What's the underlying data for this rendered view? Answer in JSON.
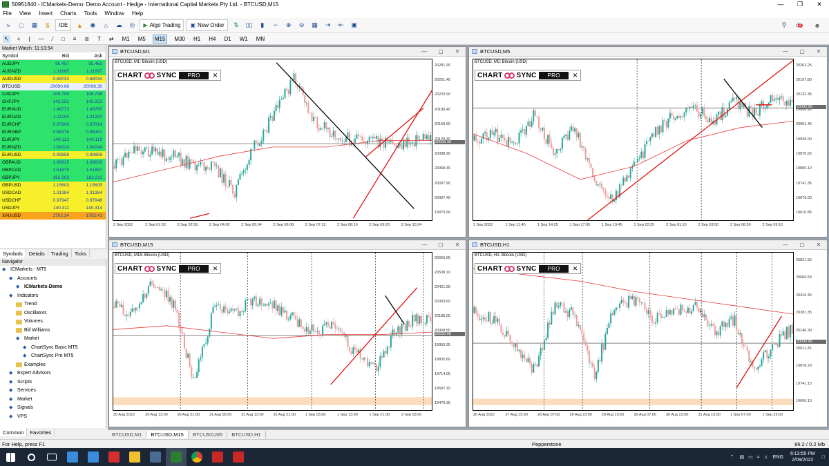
{
  "window": {
    "title": "50951840 - ICMarkets-Demo: Demo Account - Hedge - International Capital Markets Pty Ltd. - BTCUSD,M15"
  },
  "menu": [
    "File",
    "View",
    "Insert",
    "Charts",
    "Tools",
    "Window",
    "Help"
  ],
  "toolbar": {
    "ide": "IDE",
    "algo_trading": "Algo Trading",
    "new_order": "New Order",
    "notification_count": "2"
  },
  "timeframes": [
    "M1",
    "M5",
    "M15",
    "M30",
    "H1",
    "H4",
    "D1",
    "W1",
    "MN"
  ],
  "active_timeframe": "M15",
  "market_watch": {
    "header": "Market Watch: 11:13:54",
    "columns": [
      "Symbol",
      "Bid",
      "Ask"
    ],
    "rows": [
      {
        "s": "AUDJPY",
        "b": "95.457",
        "a": "95.463",
        "c": "#2ee36b"
      },
      {
        "s": "AUDNZD",
        "b": "1.11885",
        "a": "1.11897",
        "c": "#2ee36b"
      },
      {
        "s": "AUDUSD",
        "b": "0.68033",
        "a": "0.68034",
        "c": "#f6ef2a"
      },
      {
        "s": "BTCUSD",
        "b": "20090.68",
        "a": "20096.30",
        "c": "#e9f0fb"
      },
      {
        "s": "CADJPY",
        "b": "106.795",
        "a": "106.798",
        "c": "#2ee36b"
      },
      {
        "s": "CHFJPY",
        "b": "143.252",
        "a": "143.253",
        "c": "#2ee36b"
      },
      {
        "s": "EURAUD",
        "b": "1.46773",
        "a": "1.46785",
        "c": "#2ee36b"
      },
      {
        "s": "EURCAD",
        "b": "1.31194",
        "a": "1.31200",
        "c": "#2ee36b"
      },
      {
        "s": "EURCHF",
        "b": "0.97808",
        "a": "0.97814",
        "c": "#2ee36b"
      },
      {
        "s": "EURGBP",
        "b": "0.86378",
        "a": "0.86381",
        "c": "#2ee36b"
      },
      {
        "s": "EURJPY",
        "b": "140.113",
        "a": "140.119",
        "c": "#2ee36b"
      },
      {
        "s": "EURNZD",
        "b": "1.64224",
        "a": "1.64244",
        "c": "#2ee36b"
      },
      {
        "s": "EURUSD",
        "b": "0.99858",
        "a": "0.99859",
        "c": "#f6ef2a"
      },
      {
        "s": "GBPAUD",
        "b": "1.69915",
        "a": "1.69926",
        "c": "#2ee36b"
      },
      {
        "s": "GBPCAD",
        "b": "1.51879",
        "a": "1.51887",
        "c": "#2ee36b"
      },
      {
        "s": "GBPJPY",
        "b": "162.203",
        "a": "162.211",
        "c": "#2ee36b"
      },
      {
        "s": "GBPUSD",
        "b": "1.15603",
        "a": "1.15605",
        "c": "#f6ef2a"
      },
      {
        "s": "USDCAD",
        "b": "1.31384",
        "a": "1.31384",
        "c": "#f6ef2a"
      },
      {
        "s": "USDCHF",
        "b": "0.97947",
        "a": "0.97948",
        "c": "#f6ef2a"
      },
      {
        "s": "USDJPY",
        "b": "140.311",
        "a": "140.314",
        "c": "#f6ef2a"
      },
      {
        "s": "XAUUSD",
        "b": "1702.34",
        "a": "1702.41",
        "c": "#f7a21c"
      }
    ],
    "tabs": [
      "Symbols",
      "Details",
      "Trading",
      "Ticks"
    ]
  },
  "navigator": {
    "header": "Navigator",
    "items": [
      {
        "label": "ICMarkets - MT5",
        "level": 0,
        "icon": "mt5-icon",
        "bold": false
      },
      {
        "label": "Accounts",
        "level": 1,
        "icon": "accounts-icon",
        "bold": false
      },
      {
        "label": "ICMarkets-Demo",
        "level": 2,
        "icon": "account-icon",
        "bold": true
      },
      {
        "label": "Indicators",
        "level": 1,
        "icon": "indicators-icon",
        "bold": false
      },
      {
        "label": "Trend",
        "level": 2,
        "icon": "folder-icon",
        "bold": false
      },
      {
        "label": "Oscillators",
        "level": 2,
        "icon": "folder-icon",
        "bold": false
      },
      {
        "label": "Volumes",
        "level": 2,
        "icon": "folder-icon",
        "bold": false
      },
      {
        "label": "Bill Williams",
        "level": 2,
        "icon": "folder-icon",
        "bold": false
      },
      {
        "label": "Market",
        "level": 2,
        "icon": "market-icon",
        "bold": false
      },
      {
        "label": "ChartSync Basic MT5",
        "level": 3,
        "icon": "indicator-icon",
        "bold": false
      },
      {
        "label": "ChartSync Pro MT5",
        "level": 3,
        "icon": "indicator-icon",
        "bold": false
      },
      {
        "label": "Examples",
        "level": 2,
        "icon": "folder-icon",
        "bold": false
      },
      {
        "label": "Expert Advisors",
        "level": 1,
        "icon": "experts-icon",
        "bold": false
      },
      {
        "label": "Scripts",
        "level": 1,
        "icon": "scripts-icon",
        "bold": false
      },
      {
        "label": "Services",
        "level": 1,
        "icon": "services-icon",
        "bold": false
      },
      {
        "label": "Market",
        "level": 1,
        "icon": "market-icon",
        "bold": false
      },
      {
        "label": "Signals",
        "level": 1,
        "icon": "signals-icon",
        "bold": false
      },
      {
        "label": "VPS",
        "level": 1,
        "icon": "vps-icon",
        "bold": false
      }
    ],
    "tabs": [
      "Common",
      "Favorites"
    ]
  },
  "charts": [
    {
      "id": "m1",
      "title": "BTCUSD,M1",
      "symbol_line": "BTCUSD, M1:  Bitcoin (USD)",
      "prices": [
        "20281.90",
        "20251.40",
        "20220.90",
        "20190.40",
        "20159.90",
        "20129.40",
        "20098.90",
        "20068.40",
        "20037.90",
        "20007.40",
        "19976.90"
      ],
      "current": "20096.30",
      "times": [
        "2 Sep 2022",
        "2 Sep 01:52",
        "2 Sep 02:56",
        "2 Sep 04:00",
        "2 Sep 05:04",
        "2 Sep 06:08",
        "2 Sep 07:12",
        "2 Sep 08:16",
        "2 Sep 09:20",
        "2 Sep 10:24"
      ]
    },
    {
      "id": "m5",
      "title": "BTCUSD,M5",
      "symbol_line": "BTCUSD, M5:  Bitcoin (USD)",
      "prices": [
        "20263.25",
        "20197.80",
        "20132.35",
        "20066.90",
        "20001.45",
        "19936.00",
        "19870.55",
        "19805.10",
        "19741.35",
        "19676.00",
        "19610.85"
      ],
      "current": "20090.68",
      "times": [
        "1 Sep 2022",
        "1 Sep 11:45",
        "1 Sep 14:25",
        "1 Sep 17:05",
        "1 Sep 19:45",
        "1 Sep 22:25",
        "2 Sep 01:10",
        "2 Sep 03:50",
        "2 Sep 06:30",
        "2 Sep 09:10"
      ]
    },
    {
      "id": "m15",
      "title": "BTCUSD,M15",
      "symbol_line": "BTCUSD, M15:  Bitcoin (USD)",
      "prices": [
        "20656.65",
        "20539.10",
        "20421.55",
        "20303.60",
        "20185.05",
        "20068.50",
        "19950.35",
        "19832.60",
        "19714.05",
        "19597.10",
        "19479.35"
      ],
      "current": "20090.68",
      "times": [
        "30 Aug 2022",
        "30 Aug 13:00",
        "30 Aug 21:00",
        "31 Aug 05:00",
        "31 Aug 13:00",
        "31 Aug 21:00",
        "1 Sep 05:00",
        "1 Sep 13:00",
        "1 Sep 21:00",
        "2 Sep 05:00"
      ]
    },
    {
      "id": "h1",
      "title": "BTCUSD,H1",
      "symbol_line": "BTCUSD, H1:  Bitcoin (USD)",
      "prices": [
        "20821.55",
        "20606.50",
        "20416.45",
        "20281.35",
        "20146.30",
        "20011.25",
        "19876.20",
        "19741.15",
        "19606.10"
      ],
      "current": "20090.68",
      "times": [
        "26 Aug 2022",
        "27 Aug 15:00",
        "28 Aug 07:00",
        "28 Aug 23:00",
        "29 Aug 15:00",
        "30 Aug 07:00",
        "30 Aug 23:00",
        "31 Aug 15:00",
        "1 Sep 07:00",
        "1 Sep 23:00"
      ]
    }
  ],
  "chartsync": {
    "left": "CHART",
    "right": "SYNC",
    "badge": "PRO",
    "close": "✕"
  },
  "chart_tabs": [
    "BTCUSD,M1",
    "BTCUSD,M15",
    "BTCUSD,M5",
    "BTCUSD,H1"
  ],
  "active_chart_tab": "BTCUSD,M15",
  "status": {
    "help": "For Help, press F1",
    "server": "Pepperstone",
    "traffic": "86.2 / 0.2 Mb"
  },
  "tray": {
    "lang": "ENG",
    "time": "6:13:55 PM",
    "date": "2/09/2022"
  }
}
